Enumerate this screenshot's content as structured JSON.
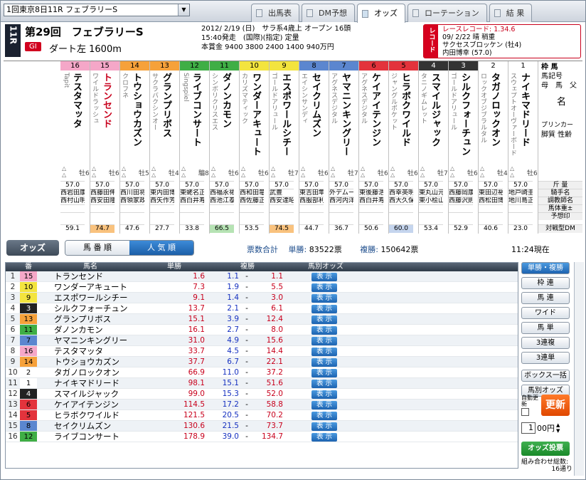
{
  "race_select": "1回東京8日11R フェブラリーS",
  "tabs": [
    "出馬表",
    "DM予想",
    "オッズ",
    "ローテーション",
    "結 果"
  ],
  "race": {
    "rnum": "11R",
    "title": "第29回　フェブラリーS",
    "grade": "GⅠ",
    "course": "ダート左 1600m",
    "info1": "2012/ 2/19 (日)　サラ系4歳上 オープン 16頭",
    "info2": "15:40発走　(国際)(指定) 定量",
    "info3": "本賞金 9400 3800 2400 1400 940万円",
    "record_label": "レコード",
    "record1": "レースレコード: 1.34.6",
    "record2": "09/ 2/22 晴 稍重",
    "record3": "サクセスブロッケン (牡4)",
    "record4": "内田博幸 (57.0)"
  },
  "waku_header": [
    {
      "w": "16 ⑧ 15",
      "color": "#f5a7c8"
    },
    {
      "w": "14 ⑦ 13",
      "color": "#f6a13a"
    },
    {
      "w": "12 ⑥ 11",
      "color": "#3fae45"
    },
    {
      "w": "10 ⑤ 9",
      "color": "#f3e43e"
    },
    {
      "w": "8 ④ 7",
      "color": "#5b86cf"
    },
    {
      "w": "6 ③ 5",
      "color": "#e3333c"
    },
    {
      "w": "4 ② 3",
      "color": "#333333"
    },
    {
      "w": "2 ① 1",
      "color": "#ffffff"
    }
  ],
  "horses": [
    {
      "n": "16",
      "name": "テスタマッタ",
      "sire": "Tapit",
      "sex": "牡6",
      "kg": "57.0",
      "jockey": "西岩田康",
      "trainer": "西村山明",
      "odds": "59.1"
    },
    {
      "n": "15",
      "name": "トランセンド",
      "sire": "ワイルドラッシュ",
      "sex": "牡6",
      "kg": "57.0",
      "jockey": "西藤田伸",
      "trainer": "西安田隆",
      "odds": "74.7",
      "red": true
    },
    {
      "n": "14",
      "name": "トウショウカズン",
      "sire": "クロフネ",
      "sex": "牡5",
      "kg": "57.0",
      "jockey": "西川田将",
      "trainer": "西領家政",
      "odds": "47.6"
    },
    {
      "n": "13",
      "name": "グランプリボス",
      "sire": "サクラバクシンオー",
      "sex": "牡4",
      "kg": "57.0",
      "jockey": "東内田博",
      "trainer": "西矢作芳",
      "odds": "27.7"
    },
    {
      "n": "12",
      "name": "ライブコンサート",
      "sire": "Singspiel",
      "sex": "騸8",
      "kg": "57.0",
      "jockey": "東蛯名正",
      "trainer": "西白井寿",
      "odds": "33.8"
    },
    {
      "n": "11",
      "name": "ダノンカモン",
      "sire": "シンボリクリスエス",
      "sex": "牡6",
      "kg": "57.0",
      "jockey": "西福永祐",
      "trainer": "西池江泰",
      "odds": "66.5"
    },
    {
      "n": "10",
      "name": "ワンダーアキュート",
      "sire": "カリズマティック",
      "sex": "牡6",
      "kg": "57.0",
      "jockey": "西和田竜",
      "trainer": "西佐藤正",
      "odds": "53.5"
    },
    {
      "n": "9",
      "name": "エスポワールシチー",
      "sire": "ゴールドアリュール",
      "sex": "牡7",
      "kg": "57.0",
      "jockey": "武豊",
      "trainer": "西安達昭",
      "odds": "74.5"
    },
    {
      "n": "8",
      "name": "セイクリムズン",
      "sire": "エイシンサンディ",
      "sex": "牡6",
      "kg": "57.0",
      "jockey": "東吉田隼",
      "trainer": "西服部利",
      "odds": "44.7"
    },
    {
      "n": "7",
      "name": "ヤマニンキングリー",
      "sire": "アグネスデジタル",
      "sex": "牡7",
      "kg": "57.0",
      "jockey": "外デムー",
      "trainer": "西河内洋",
      "odds": "36.7"
    },
    {
      "n": "6",
      "name": "ケイアイテンジン",
      "sire": "アグネスデジタル",
      "sex": "牡6",
      "kg": "57.0",
      "jockey": "東後藤浩",
      "trainer": "西白井寿",
      "odds": "50.6"
    },
    {
      "n": "5",
      "name": "ヒラボクワイルド",
      "sire": "ジャングルポケット",
      "sex": "牡6",
      "kg": "57.0",
      "jockey": "西幸英明",
      "trainer": "西大久保",
      "odds": "60.0"
    },
    {
      "n": "4",
      "name": "スマイルジャック",
      "sire": "タニノギムレット",
      "sex": "牡7",
      "kg": "57.0",
      "jockey": "東丸山元",
      "trainer": "東小桧山",
      "odds": "53.4"
    },
    {
      "n": "3",
      "name": "シルクフォーチュン",
      "sire": "ゴールドアリュール",
      "sex": "牡6",
      "kg": "57.0",
      "jockey": "西藤岡康",
      "trainer": "西藤沢則",
      "odds": "52.9"
    },
    {
      "n": "2",
      "name": "タガノロックオン",
      "sire": "ロックオブジブラルタル",
      "sex": "牡4",
      "kg": "57.0",
      "jockey": "東田辺裕",
      "trainer": "西松田博",
      "odds": "40.6"
    },
    {
      "n": "1",
      "name": "ナイキマドリード",
      "sire": "スウェプトオーヴァーボード",
      "sex": "牡6",
      "kg": "57.0",
      "jockey": "地戸崎圭",
      "trainer": "地川島正",
      "odds": "23.0"
    }
  ],
  "row_labels": [
    "斤 量",
    "騎手名",
    "調教師名",
    "馬体重±",
    "予想印",
    "対戦型DM"
  ],
  "col_labels": {
    "l1": "枠 馬",
    "l2": "馬記号",
    "l3": "母　馬　父",
    "l4": "名",
    "l5": "プリンカー",
    "l6": "脚質 性齢"
  },
  "odds_label": "オッズ",
  "sort": [
    "馬 番 順",
    "人 気 順"
  ],
  "summary": {
    "label": "票数合計",
    "tansho_l": "単勝:",
    "tansho": "83522票",
    "fuku_l": "複勝:",
    "fuku": "150642票"
  },
  "time": "11:24現在",
  "table_head": [
    "番",
    "馬名",
    "単勝",
    "複勝",
    "馬別オッズ"
  ],
  "rows": [
    {
      "r": "1",
      "n": "15",
      "c": "#f5a7c8",
      "name": "トランセンド",
      "t": "1.6",
      "f1": "1.1",
      "f2": "1.1"
    },
    {
      "r": "2",
      "n": "10",
      "c": "#f3e43e",
      "name": "ワンダーアキュート",
      "t": "7.3",
      "f1": "1.9",
      "f2": "5.5"
    },
    {
      "r": "3",
      "n": "9",
      "c": "#f3e43e",
      "name": "エスポワールシチー",
      "t": "9.1",
      "f1": "1.4",
      "f2": "3.0"
    },
    {
      "r": "4",
      "n": "3",
      "c": "#222",
      "name": "シルクフォーチュン",
      "t": "13.7",
      "f1": "2.1",
      "f2": "6.1"
    },
    {
      "r": "5",
      "n": "13",
      "c": "#f6a13a",
      "name": "グランプリボス",
      "t": "15.1",
      "f1": "3.9",
      "f2": "12.4"
    },
    {
      "r": "6",
      "n": "11",
      "c": "#3fae45",
      "name": "ダノンカモン",
      "t": "16.1",
      "f1": "2.7",
      "f2": "8.0"
    },
    {
      "r": "7",
      "n": "7",
      "c": "#5b86cf",
      "name": "ヤマニンキングリー",
      "t": "31.0",
      "f1": "4.9",
      "f2": "15.6"
    },
    {
      "r": "8",
      "n": "16",
      "c": "#f5a7c8",
      "name": "テスタマッタ",
      "t": "33.7",
      "f1": "4.5",
      "f2": "14.4"
    },
    {
      "r": "9",
      "n": "14",
      "c": "#f6a13a",
      "name": "トウショウカズン",
      "t": "37.7",
      "f1": "6.7",
      "f2": "22.1"
    },
    {
      "r": "10",
      "n": "2",
      "c": "#fff",
      "name": "タガノロックオン",
      "t": "66.9",
      "f1": "11.0",
      "f2": "37.2"
    },
    {
      "r": "11",
      "n": "1",
      "c": "#fff",
      "name": "ナイキマドリード",
      "t": "98.1",
      "f1": "15.1",
      "f2": "51.6"
    },
    {
      "r": "12",
      "n": "4",
      "c": "#222",
      "name": "スマイルジャック",
      "t": "99.0",
      "f1": "15.3",
      "f2": "52.0"
    },
    {
      "r": "13",
      "n": "6",
      "c": "#e3333c",
      "name": "ケイアイテンジン",
      "t": "114.5",
      "f1": "17.2",
      "f2": "58.8"
    },
    {
      "r": "14",
      "n": "5",
      "c": "#e3333c",
      "name": "ヒラボクワイルド",
      "t": "121.5",
      "f1": "20.5",
      "f2": "70.2"
    },
    {
      "r": "15",
      "n": "8",
      "c": "#5b86cf",
      "name": "セイクリムズン",
      "t": "130.6",
      "f1": "21.5",
      "f2": "73.7"
    },
    {
      "r": "16",
      "n": "12",
      "c": "#3fae45",
      "name": "ライブコンサート",
      "t": "178.9",
      "f1": "39.0",
      "f2": "134.7"
    }
  ],
  "hyoji": "表 示",
  "right_buttons": [
    "単勝・複勝",
    "枠 連",
    "馬 連",
    "ワイド",
    "馬 単",
    "3連複",
    "3連単"
  ],
  "box_buttons": [
    "ボックス一括",
    "馬別オッズ"
  ],
  "auto_label": "自動更新",
  "renew": "更新",
  "amount": "1",
  "yen": "00円",
  "toh": "オッズ投票",
  "combo": "組み合わせ総数:",
  "combo_n": "16通り"
}
